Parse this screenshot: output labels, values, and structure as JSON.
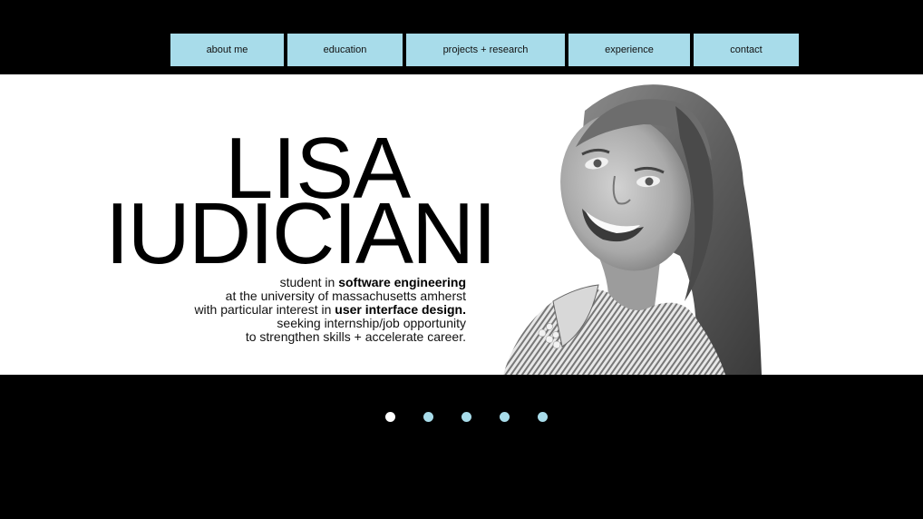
{
  "nav": {
    "items": [
      {
        "label": "about me"
      },
      {
        "label": "education"
      },
      {
        "label": "projects + research"
      },
      {
        "label": "experience"
      },
      {
        "label": "contact"
      }
    ]
  },
  "hero": {
    "first_name": "LISA",
    "last_name": "IUDICIANI",
    "bio": {
      "line1_pre": "student in ",
      "line1_bold": "software engineering",
      "line2": "at the university of massachusetts amherst",
      "line3_pre": "with particular interest in ",
      "line3_bold": "user interface design.",
      "line4": "seeking internship/job opportunity",
      "line5": "to strengthen skills + accelerate career."
    }
  },
  "carousel": {
    "slide_count": 5,
    "active_index": 0
  },
  "colors": {
    "accent": "#a8dcea",
    "background": "#000000",
    "hero_background": "#ffffff"
  }
}
